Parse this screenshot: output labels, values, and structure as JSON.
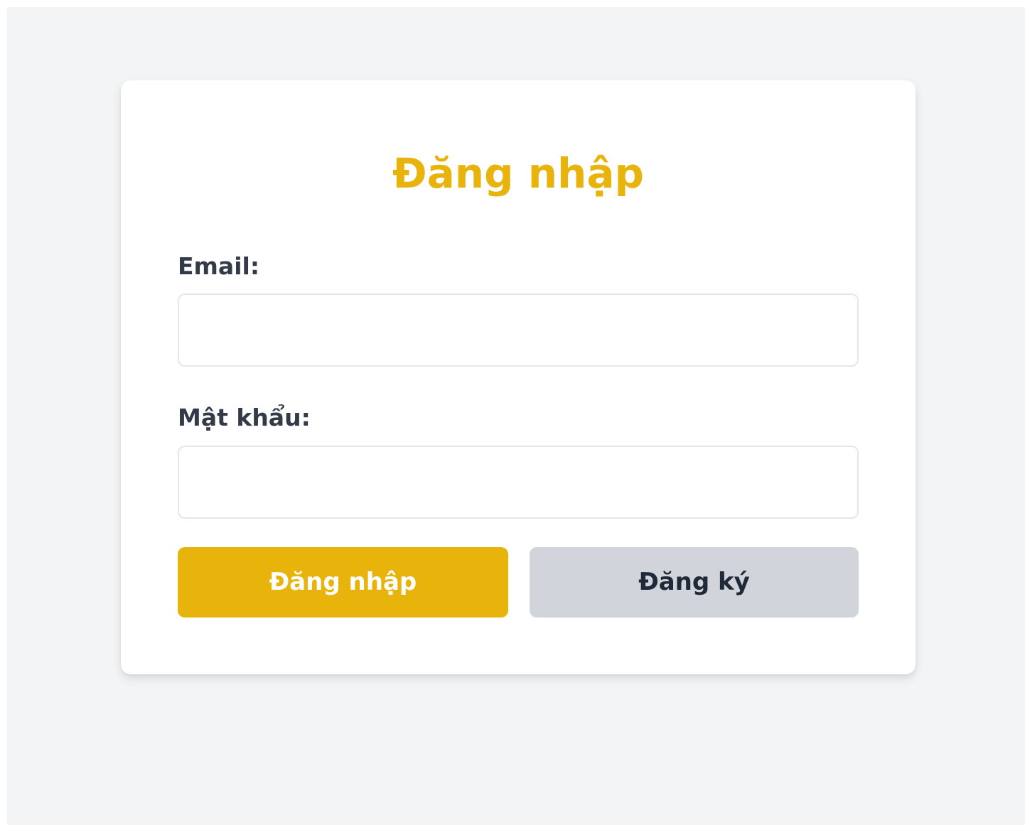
{
  "colors": {
    "accent": "#e8b40b",
    "page_background": "#f3f4f6",
    "card_background": "#ffffff",
    "secondary_button": "#d1d5db",
    "label_text": "#333a48"
  },
  "login_form": {
    "title": "Đăng nhập",
    "email": {
      "label": "Email:",
      "value": "",
      "placeholder": ""
    },
    "password": {
      "label": "Mật khẩu:",
      "value": "",
      "placeholder": ""
    },
    "buttons": {
      "login_label": "Đăng nhập",
      "register_label": "Đăng ký"
    }
  }
}
